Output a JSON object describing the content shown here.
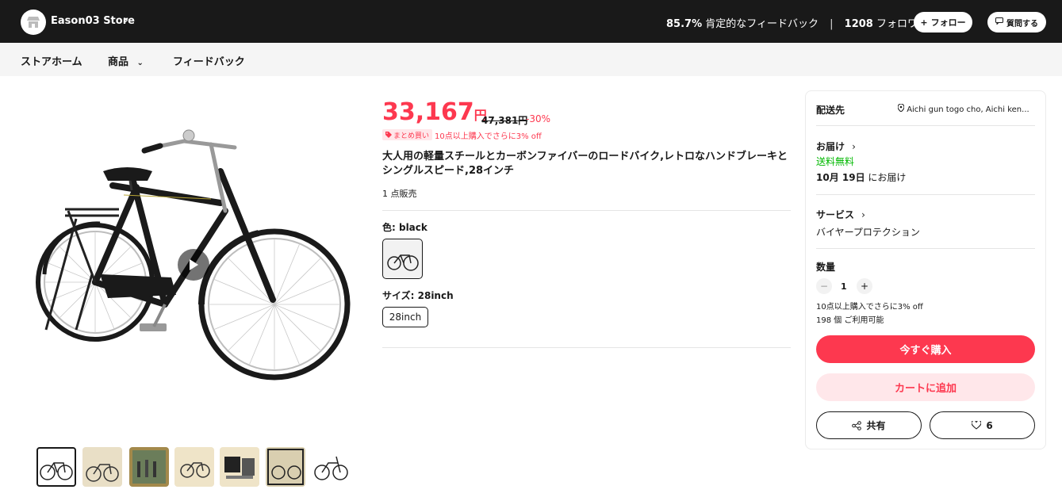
{
  "header": {
    "store_name": "Eason03 Store",
    "feedback_pct": "85.7%",
    "feedback_label": "肯定的なフィードバック",
    "followers_count": "1208",
    "followers_label": "フォロワー",
    "follow_button": "フォロー",
    "ask_button": "質問する"
  },
  "nav": {
    "items": [
      "ストアホーム",
      "商品",
      "フィードバック"
    ]
  },
  "product": {
    "price_value": "33,167",
    "price_unit": "円",
    "original_price": "47,381円",
    "discount": "-30%",
    "bulk_badge": "まとめ買い",
    "bulk_text": "10点以上購入でさらに3% off",
    "title": "大人用の軽量スチールとカーボンファイバーのロードバイク,レトロなハンドブレーキとシングルスピード,28インチ",
    "sold": "1 点販売",
    "color_label": "色: black",
    "size_label": "サイズ: 28inch",
    "size_option": "28inch"
  },
  "panel": {
    "ship_to_label": "配送先",
    "ship_to_value": "Aichi gun togo cho, Aichi ken...",
    "delivery_label": "お届け",
    "free_shipping": "送料無料",
    "delivery_date": "10月 19日",
    "delivery_suffix": "にお届け",
    "service_label": "サービス",
    "service_value": "バイヤープロテクション",
    "quantity_label": "数量",
    "quantity_value": "1",
    "qty_promo": "10点以上購入でさらに3% off",
    "stock": "198 個 ご利用可能",
    "buy_now": "今すぐ購入",
    "add_to_cart": "カートに追加",
    "share": "共有",
    "likes": "6"
  },
  "colors": {
    "accent": "#fd384f",
    "accent_light": "#ffe7ea",
    "header_bg": "#191919",
    "success": "#00b800"
  },
  "icons": [
    "store-icon",
    "chevron-right-icon",
    "plus-icon",
    "chat-icon",
    "chevron-down-icon",
    "play-icon",
    "tag-icon",
    "location-pin-icon",
    "minus-icon",
    "share-icon",
    "heart-icon"
  ]
}
